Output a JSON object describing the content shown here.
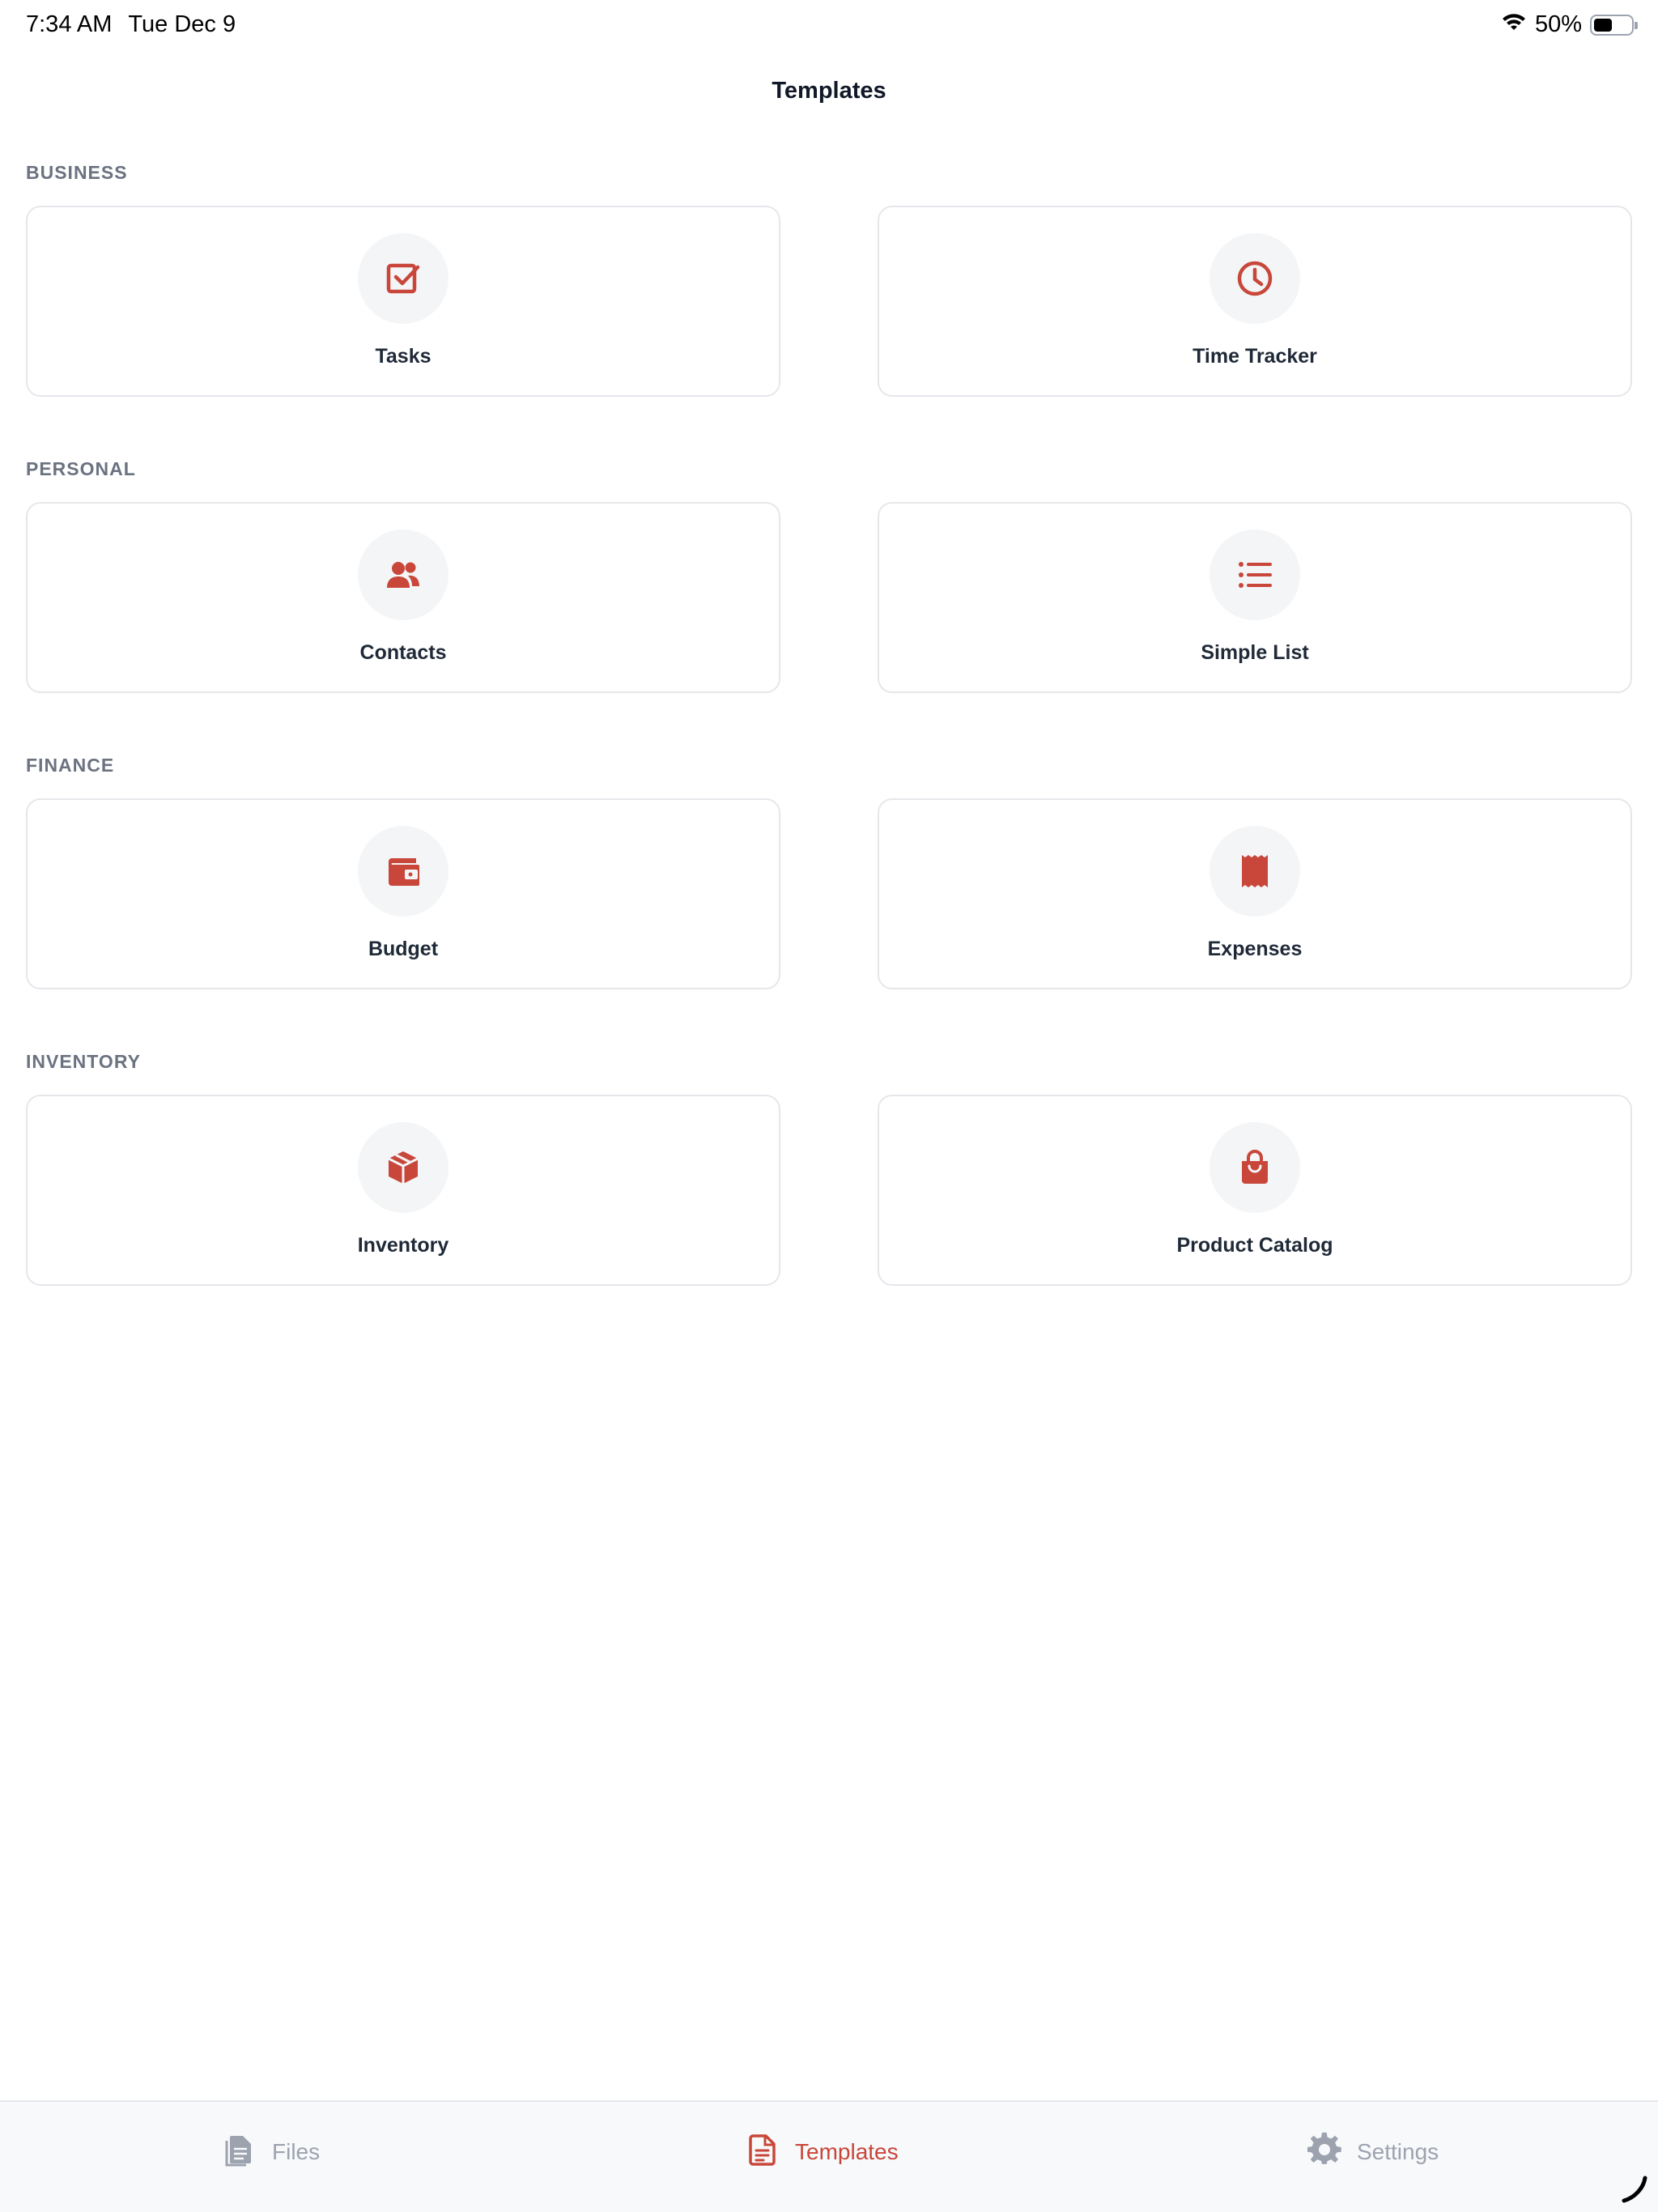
{
  "status_bar": {
    "time": "7:34 AM",
    "date": "Tue Dec 9",
    "battery": "50%",
    "wifi_icon": "wifi-icon",
    "battery_level": 0.5
  },
  "header": {
    "title": "Templates"
  },
  "colors": {
    "accent": "#c8473a",
    "muted": "#9ca3af",
    "section": "#6b7280"
  },
  "sections": [
    {
      "label": "BUSINESS",
      "items": [
        {
          "label": "Tasks",
          "icon": "checkbox-icon"
        },
        {
          "label": "Time Tracker",
          "icon": "clock-icon"
        }
      ]
    },
    {
      "label": "PERSONAL",
      "items": [
        {
          "label": "Contacts",
          "icon": "users-icon"
        },
        {
          "label": "Simple List",
          "icon": "list-icon"
        }
      ]
    },
    {
      "label": "FINANCE",
      "items": [
        {
          "label": "Budget",
          "icon": "wallet-icon"
        },
        {
          "label": "Expenses",
          "icon": "receipt-icon"
        }
      ]
    },
    {
      "label": "INVENTORY",
      "items": [
        {
          "label": "Inventory",
          "icon": "box-icon"
        },
        {
          "label": "Product Catalog",
          "icon": "shopping-bag-icon"
        }
      ]
    }
  ],
  "tab_bar": {
    "tabs": [
      {
        "label": "Files",
        "icon": "document-icon",
        "active": false
      },
      {
        "label": "Templates",
        "icon": "template-document-icon",
        "active": true
      },
      {
        "label": "Settings",
        "icon": "gear-icon",
        "active": false
      }
    ]
  }
}
